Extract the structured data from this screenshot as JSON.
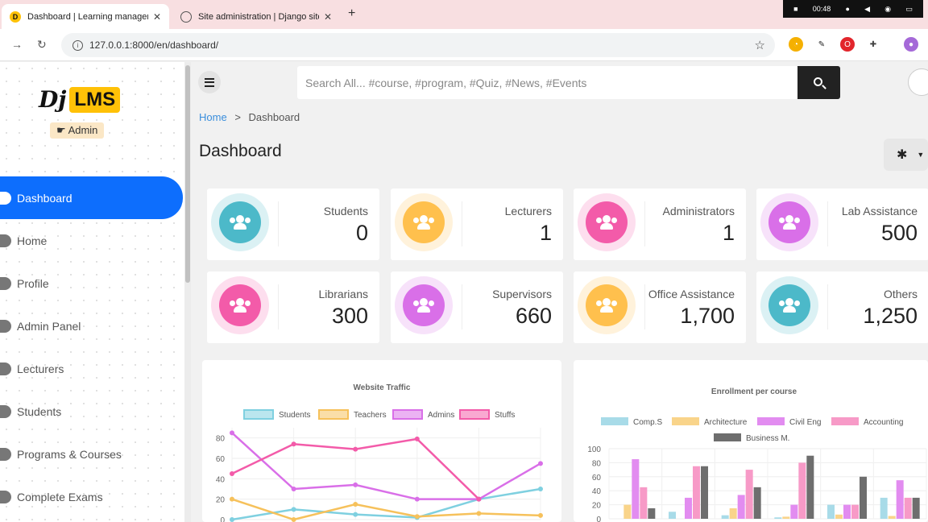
{
  "browser": {
    "tabs": [
      {
        "title": "Dashboard | Learning managem",
        "active": true
      },
      {
        "title": "Site administration | Django site",
        "active": false
      }
    ],
    "url": "127.0.0.1:8000/en/dashboard/",
    "system_time": "00:48"
  },
  "sidebar": {
    "logo_main": "Dj",
    "logo_badge": "LMS",
    "role_badge": "Admin",
    "items": [
      {
        "label": "Dashboard",
        "active": true
      },
      {
        "label": "Home"
      },
      {
        "label": "Profile"
      },
      {
        "label": "Admin Panel"
      },
      {
        "label": "Lecturers"
      },
      {
        "label": "Students"
      },
      {
        "label": "Programs & Courses"
      },
      {
        "label": "Complete Exams"
      }
    ]
  },
  "topbar": {
    "search_placeholder": "Search All... #course, #program, #Quiz, #News, #Events"
  },
  "breadcrumb": {
    "home": "Home",
    "sep": ">",
    "current": "Dashboard"
  },
  "page_title": "Dashboard",
  "colors": {
    "teal": "#4cb9c9",
    "yellow": "#ffc04d",
    "pink": "#f35ba9",
    "purple": "#d96fe8",
    "blue": "#0d6efd"
  },
  "cards": [
    {
      "label": "Students",
      "value": "0",
      "color": "teal"
    },
    {
      "label": "Lecturers",
      "value": "1",
      "color": "yellow"
    },
    {
      "label": "Administrators",
      "value": "1",
      "color": "pink"
    },
    {
      "label": "Lab Assistance",
      "value": "500",
      "color": "purple"
    },
    {
      "label": "Librarians",
      "value": "300",
      "color": "pink"
    },
    {
      "label": "Supervisors",
      "value": "660",
      "color": "purple"
    },
    {
      "label": "Office Assistance",
      "value": "1,700",
      "color": "yellow"
    },
    {
      "label": "Others",
      "value": "1,250",
      "color": "teal"
    }
  ],
  "chart_data": [
    {
      "type": "line",
      "title": "Website Traffic",
      "y_ticks": [
        "0",
        "20",
        "40",
        "60",
        "80"
      ],
      "ylim": [
        0,
        90
      ],
      "series": [
        {
          "name": "Students",
          "color": "#7fd0e0",
          "values": [
            0,
            10,
            5,
            2,
            20,
            30
          ]
        },
        {
          "name": "Teachers",
          "color": "#f6c15b",
          "values": [
            20,
            0,
            15,
            3,
            6,
            4
          ]
        },
        {
          "name": "Admins",
          "color": "#d96fe8",
          "values": [
            85,
            30,
            34,
            20,
            20,
            55
          ]
        },
        {
          "name": "Stuffs",
          "color": "#f35ba9",
          "values": [
            45,
            74,
            69,
            79,
            20,
            null
          ]
        }
      ]
    },
    {
      "type": "bar",
      "title": "Enrollment per course",
      "y_ticks": [
        "0",
        "20",
        "40",
        "60",
        "80",
        "100"
      ],
      "ylim": [
        0,
        100
      ],
      "series": [
        {
          "name": "Comp.S",
          "color": "#a8dbe8",
          "values": [
            0,
            10,
            5,
            2,
            20,
            30
          ]
        },
        {
          "name": "Architecture",
          "color": "#f9d48a",
          "values": [
            20,
            0,
            15,
            3,
            6,
            4
          ]
        },
        {
          "name": "Civil Eng",
          "color": "#e28cf0",
          "values": [
            85,
            30,
            34,
            20,
            20,
            55
          ]
        },
        {
          "name": "Accounting",
          "color": "#f79ac7",
          "values": [
            45,
            75,
            70,
            80,
            20,
            30
          ]
        },
        {
          "name": "Business M.",
          "color": "#6e6e6e",
          "values": [
            15,
            75,
            45,
            90,
            60,
            30
          ]
        }
      ]
    }
  ]
}
